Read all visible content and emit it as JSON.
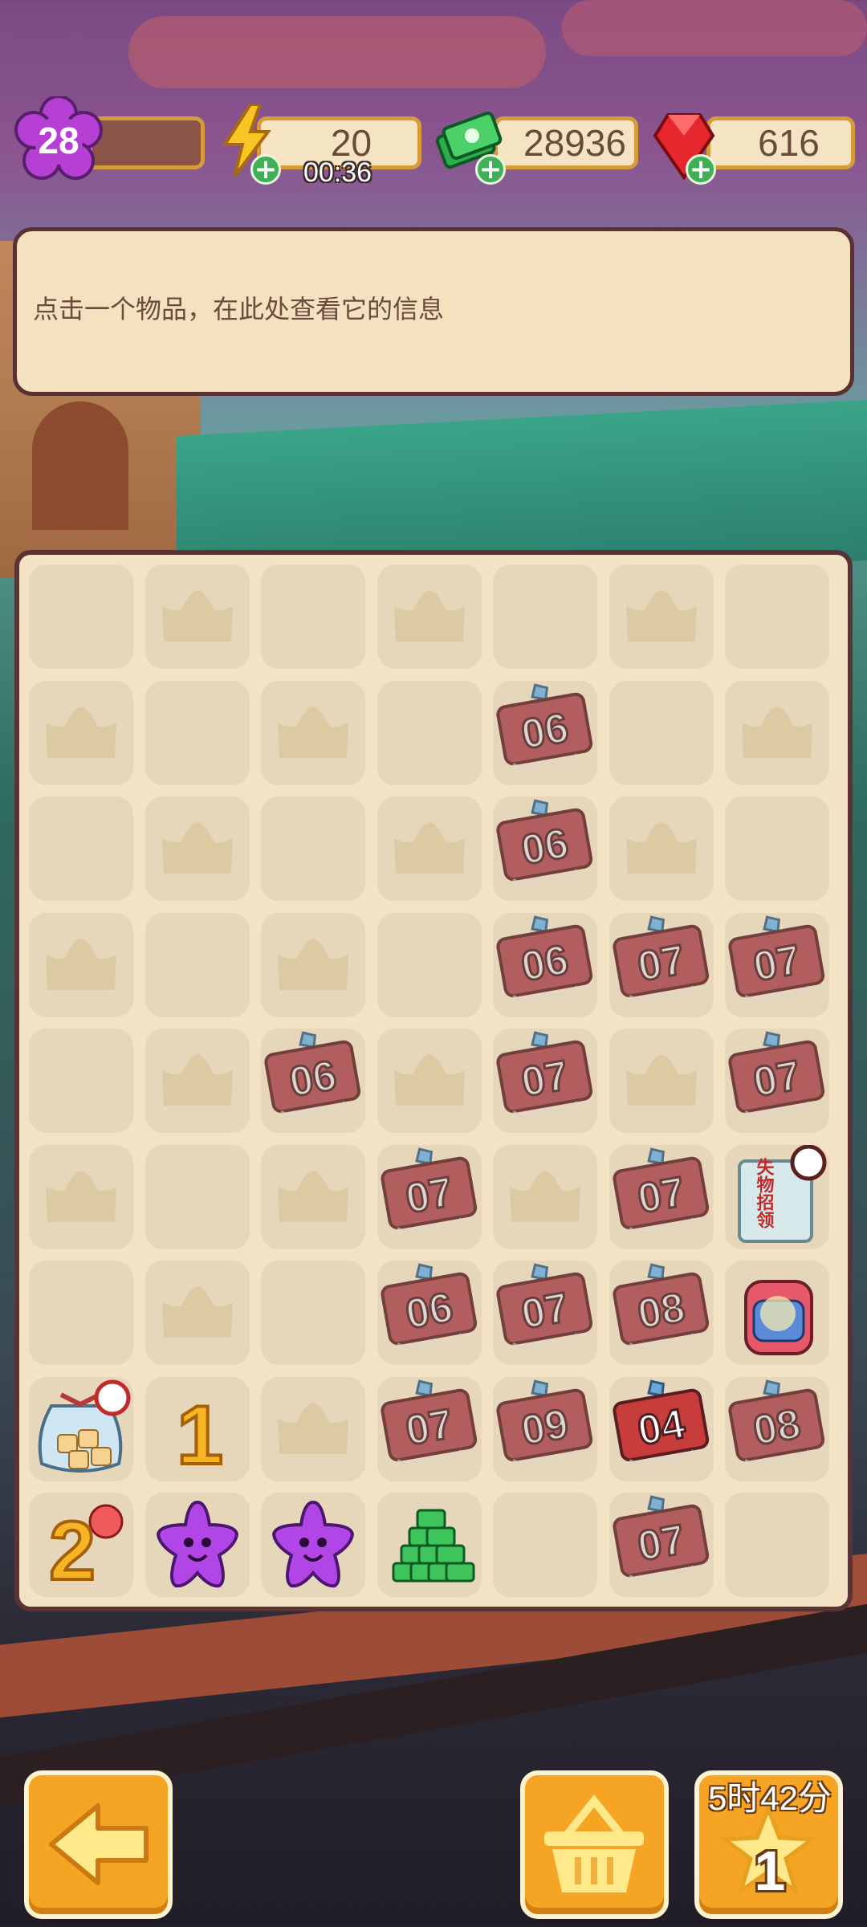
{
  "hud": {
    "level": "28",
    "level_progress": 0.1,
    "energy": "20",
    "energy_timer": "00:36",
    "cash": "28936",
    "gems": "616"
  },
  "info_panel": {
    "text": "点击一个物品，在此处查看它的信息"
  },
  "board": {
    "rows": 9,
    "cols": 7,
    "cells": [
      [
        "empty",
        "crown",
        "empty",
        "crown",
        "empty",
        "crown",
        "empty"
      ],
      [
        "crown",
        "empty",
        "crown",
        "empty",
        "ticket:06",
        "empty",
        "crown"
      ],
      [
        "empty",
        "crown",
        "empty",
        "crown",
        "ticket:06",
        "crown",
        "empty"
      ],
      [
        "crown",
        "empty",
        "crown",
        "empty",
        "ticket:06",
        "ticket:07",
        "ticket:07"
      ],
      [
        "empty",
        "crown",
        "ticket:06",
        "crown",
        "ticket:07",
        "crown",
        "ticket:07"
      ],
      [
        "crown",
        "empty",
        "crown",
        "ticket:07",
        "crown",
        "ticket:07",
        "lostfound"
      ],
      [
        "empty",
        "crown",
        "empty",
        "ticket:06",
        "ticket:07",
        "ticket:08",
        "backpack"
      ],
      [
        "sugarbag",
        "balloon:1",
        "crown",
        "ticket:07",
        "ticket:09",
        "ticket:04",
        "ticket:08"
      ],
      [
        "balloon:2",
        "star",
        "star",
        "cashpile",
        "empty",
        "ticket:07",
        "empty"
      ]
    ]
  },
  "lost_found_label": "失物招领",
  "bottom": {
    "star_timer": "5时42分",
    "star_count": "1"
  }
}
